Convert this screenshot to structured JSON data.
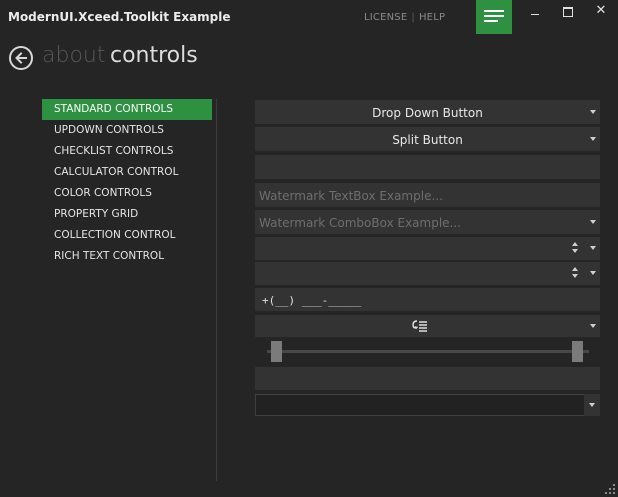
{
  "window": {
    "title": "ModernUI.Xceed.Toolkit Example",
    "links": [
      "LICENSE",
      "HELP"
    ],
    "link_separator": "|",
    "accent_color": "#2e9141",
    "close_glyph": "✕"
  },
  "header": {
    "breadcrumb_inactive": "about",
    "breadcrumb_active": "controls"
  },
  "sidebar": {
    "selected_index": 0,
    "items": [
      {
        "label": "STANDARD CONTROLS"
      },
      {
        "label": "UPDOWN CONTROLS"
      },
      {
        "label": "CHECKLIST CONTROLS"
      },
      {
        "label": "CALCULATOR CONTROL"
      },
      {
        "label": "COLOR CONTROLS"
      },
      {
        "label": "PROPERTY GRID"
      },
      {
        "label": "COLLECTION CONTROL"
      },
      {
        "label": "RICH TEXT CONTROL"
      }
    ]
  },
  "controls": {
    "dropdown_button": {
      "label": "Drop Down Button"
    },
    "split_button": {
      "label": "Split Button"
    },
    "plain_textbox": {
      "value": ""
    },
    "watermark_textbox": {
      "placeholder": "Watermark TextBox Example..."
    },
    "watermark_combobox": {
      "placeholder": "Watermark ComboBox Example..."
    },
    "updown_1": {
      "value": ""
    },
    "updown_2": {
      "value": ""
    },
    "masked_textbox": {
      "value": "+(__) ___-_____"
    },
    "range_slider": {
      "lower_fraction": 0.0,
      "upper_fraction": 1.0
    },
    "empty_field": {
      "value": ""
    },
    "bottom_combobox": {
      "value": ""
    }
  }
}
